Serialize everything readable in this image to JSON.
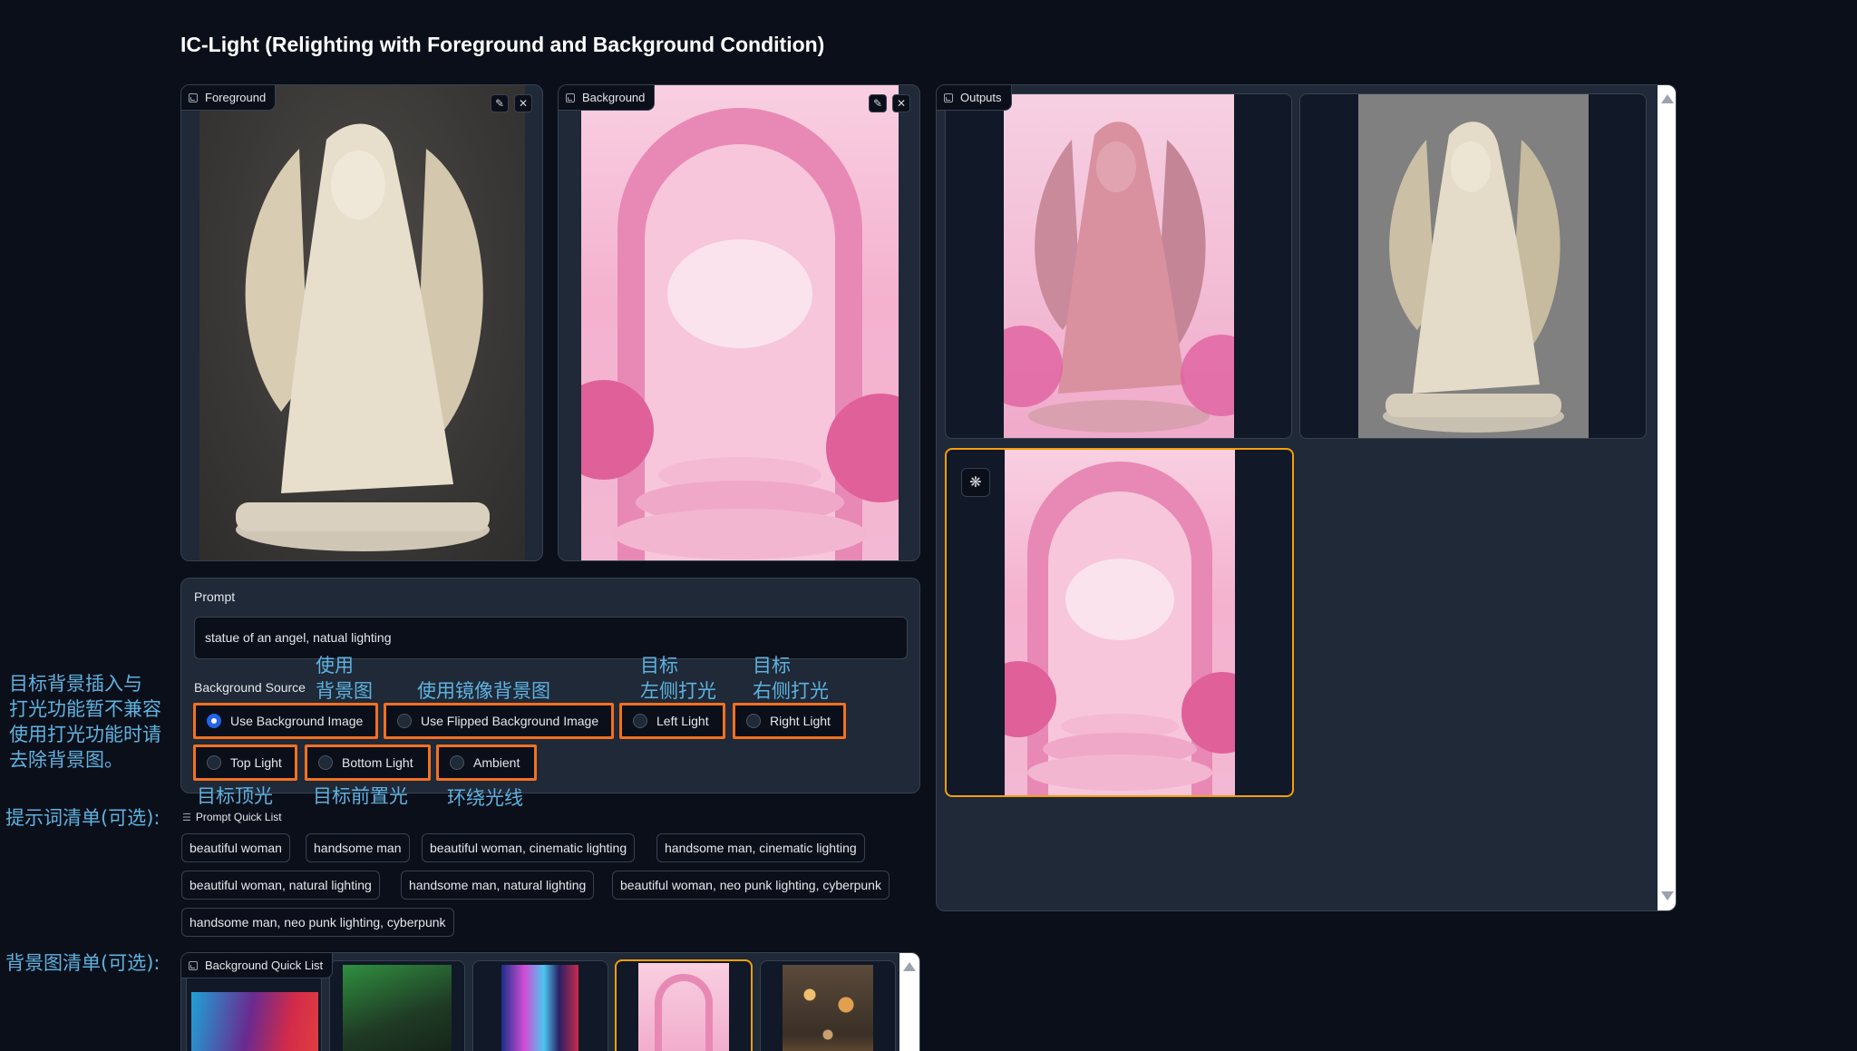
{
  "app": {
    "title": "IC-Light (Relighting with Foreground and Background Condition)"
  },
  "foreground": {
    "label": "Foreground"
  },
  "background": {
    "label": "Background"
  },
  "outputs": {
    "label": "Outputs"
  },
  "prompt": {
    "label": "Prompt",
    "value": "statue of an angel, natual lighting"
  },
  "background_source": {
    "label": "Background Source",
    "selected": "Use Background Image",
    "options": [
      "Use Background Image",
      "Use Flipped Background Image",
      "Left Light",
      "Right Light",
      "Top Light",
      "Bottom Light",
      "Ambient"
    ]
  },
  "annotations": {
    "side_note": [
      "目标背景插入与",
      "打光功能暂不兼容",
      "使用打光功能时请",
      "去除背景图。"
    ],
    "use_bg": [
      "使用",
      "背景图"
    ],
    "use_flipped": "使用镜像背景图",
    "left": [
      "目标",
      "左侧打光"
    ],
    "right": [
      "目标",
      "右侧打光"
    ],
    "top": "目标顶光",
    "bottom": "目标前置光",
    "ambient": "环绕光线",
    "prompt_list": "提示词清单(可选):",
    "bg_list": "背景图清单(可选):"
  },
  "prompt_quick_list": {
    "label": "Prompt Quick List",
    "items": [
      "beautiful woman",
      "handsome man",
      "beautiful woman, cinematic lighting",
      "handsome man, cinematic lighting",
      "beautiful woman, natural lighting",
      "handsome man, natural lighting",
      "beautiful woman, neo punk lighting, cyberpunk",
      "handsome man, neo punk lighting, cyberpunk"
    ]
  },
  "background_quick_list": {
    "label": "Background Quick List"
  },
  "colors": {
    "accent_orange": "#f37021",
    "selected_blue": "#2563eb",
    "annotation_blue": "#5fb2e0"
  }
}
